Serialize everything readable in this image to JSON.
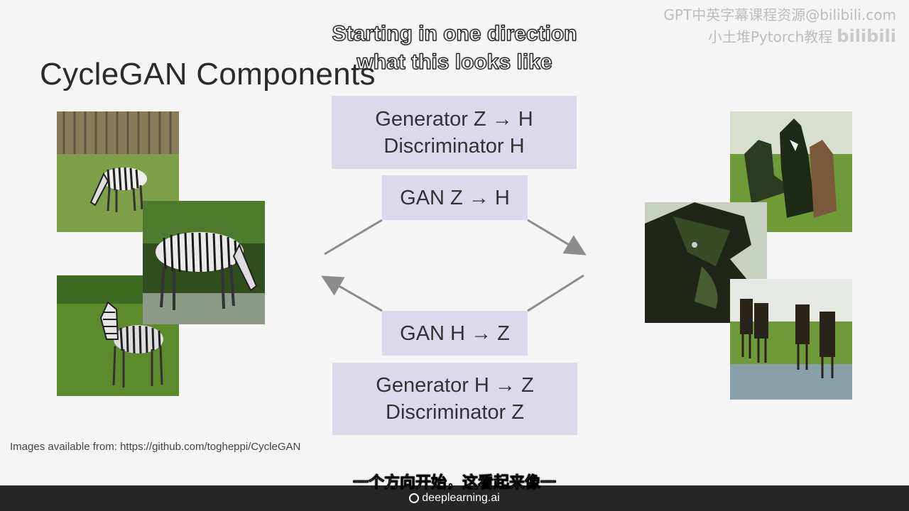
{
  "slide": {
    "title": "CycleGAN Components",
    "credit": "Images available from: https://github.com/togheppi/CycleGAN"
  },
  "boxes": {
    "top_line1": "Generator Z → H",
    "top_line2": "Discriminator H",
    "gan_top": "GAN Z → H",
    "gan_bottom": "GAN H → Z",
    "bottom_line1": "Generator H → Z",
    "bottom_line2": "Discriminator Z"
  },
  "subtitles": {
    "english_line1": "Starting in one direction",
    "english_line2": "what this looks like",
    "chinese": "一个方向开始，这看起来像一"
  },
  "watermark": {
    "line1": "GPT中英字幕课程资源@bilibili.com",
    "line2": "小土堆Pytorch教程",
    "bili": "bilibili"
  },
  "footer": {
    "brand": "deeplearning.ai"
  },
  "colors": {
    "box_fill": "#dcd9ea",
    "arrow": "#8c8c8c",
    "footer_bar": "#262626"
  },
  "icons": {
    "brand_logo": "deeplearning-logo-icon"
  }
}
